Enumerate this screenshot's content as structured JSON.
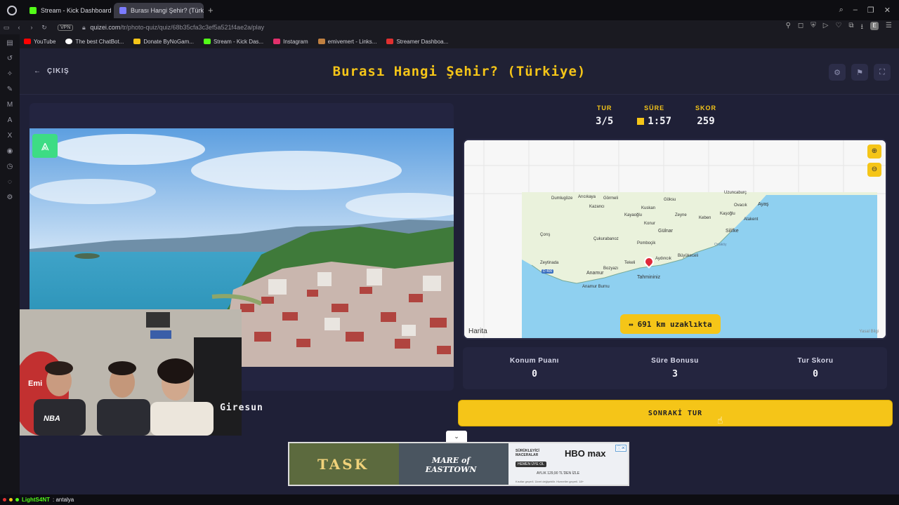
{
  "browser": {
    "tabs": [
      {
        "label": "Stream - Kick Dashboard",
        "active": false,
        "color": "#53fc18"
      },
      {
        "label": "Burası Hangi Şehir? (Türk",
        "active": true,
        "color": "#7b7bff"
      }
    ],
    "url_host": "quizei.com",
    "url_path": "/tr/photo-quiz/quiz/68b35cfa3c3ef5a521f4ae2a/play",
    "vpn_label": "VPN",
    "profile_initial": "E"
  },
  "bookmarks": [
    {
      "label": "YouTube",
      "color": "#ff0000"
    },
    {
      "label": "The best ChatBot...",
      "color": "#ffffff"
    },
    {
      "label": "Donate ByNoGam...",
      "color": "#f5c518"
    },
    {
      "label": "Stream - Kick Das...",
      "color": "#53fc18"
    },
    {
      "label": "Instagram",
      "color": "#e1306c"
    },
    {
      "label": "emivemert - Links...",
      "color": "#c08040"
    },
    {
      "label": "Streamer Dashboa...",
      "color": "#e03030"
    }
  ],
  "header": {
    "back_label": "ÇIKIŞ",
    "title": "Burası Hangi Şehir? (Türkiye)"
  },
  "stats": {
    "round_label": "TUR",
    "round_value": "3/5",
    "time_label": "SÜRE",
    "time_value": "1:57",
    "score_label": "SKOR",
    "score_value": "259"
  },
  "map": {
    "places": [
      "Dumlugöze",
      "Arıcıkaya",
      "Görmeli",
      "Göksu",
      "Uzuncaburç",
      "Kazancı",
      "Kuskan",
      "Ovacık",
      "Ayaş",
      "Kayaoğlu",
      "Zeyne",
      "Kaşoğlu",
      "Keben",
      "Atakent",
      "Konur",
      "Gülnar",
      "Silifke",
      "Ortaköy",
      "Çorış",
      "Çukurabanoz",
      "Pomboçik",
      "Aydıncık",
      "Büyükeceli",
      "Zeytinada",
      "Tekeli",
      "Bozyazı",
      "Anamur",
      "Anamur Burnu"
    ],
    "marker_label": "Tahmininiz",
    "road_sign": "D 400",
    "distance_text": "691 km uzaklıkta",
    "attribution": "Harita",
    "legal": "Yasal Bilgi"
  },
  "scores": {
    "location_label": "Konum Puanı",
    "location_value": "0",
    "bonus_label": "Süre Bonusu",
    "bonus_value": "3",
    "round_score_label": "Tur Skoru",
    "round_score_value": "0"
  },
  "answer": "Giresun",
  "next_button": "SONRAKİ TUR",
  "ad": {
    "brand1": "TASK",
    "brand2": "MARE of EASTTOWN",
    "brand3": "HBO max",
    "promo": "SÜRÜKLEYİCİ MACERALAR",
    "cta": "HEMEN ÜYE OL",
    "price": "AYLIK 129,90 TL'DEN İZLE",
    "legal": "Kısıtlar geçerli. Ücret değişebilir. Hizmetler geçerli. 18+"
  },
  "webcam": {
    "shirt_text": "NBA",
    "banner_text": "Emi"
  },
  "statusbar": {
    "user": "LightS4NT",
    "message": ": antalya"
  },
  "colors": {
    "accent": "#f5c518",
    "app_bg": "#1f2037",
    "panel": "#24253f"
  }
}
